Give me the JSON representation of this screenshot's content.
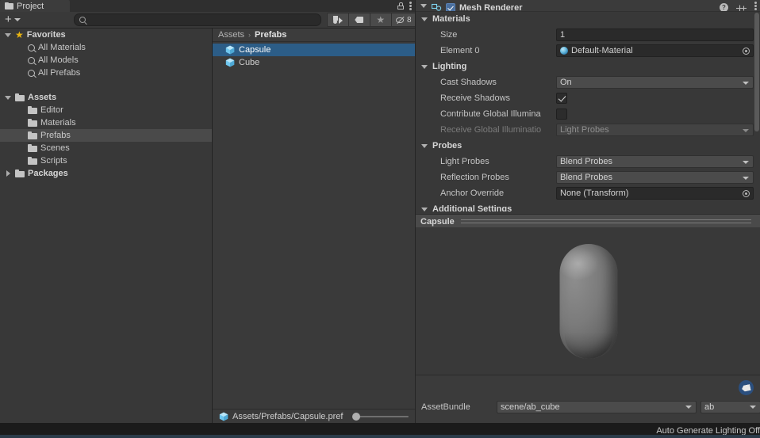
{
  "project_panel": {
    "tab_label": "Project",
    "tab_icon": "folder-icon",
    "lock_icon": "lock-icon",
    "menu_icon": "kebab-menu-icon",
    "toolbar": {
      "add_label": "+",
      "add_icon": "plus-icon",
      "dropdown_icon": "chevron-down-icon",
      "search_placeholder": "",
      "search_value": "",
      "search_icon": "search-icon",
      "filter_type_icon": "type-filter-icon",
      "filter_label_icon": "label-filter-icon",
      "filter_favorite_icon": "star-icon",
      "hidden_icon": "eye-off-icon",
      "hidden_count": "8"
    },
    "tree": [
      {
        "label": "Favorites",
        "icon": "star-icon",
        "indent": 0,
        "arrow": "down",
        "bold": true,
        "selected": false
      },
      {
        "label": "All Materials",
        "icon": "search-icon",
        "indent": 1,
        "arrow": "none",
        "bold": false,
        "selected": false
      },
      {
        "label": "All Models",
        "icon": "search-icon",
        "indent": 1,
        "arrow": "none",
        "bold": false,
        "selected": false
      },
      {
        "label": "All Prefabs",
        "icon": "search-icon",
        "indent": 1,
        "arrow": "none",
        "bold": false,
        "selected": false
      },
      {
        "label": "",
        "icon": "spacer",
        "indent": 0,
        "arrow": "none",
        "bold": false,
        "selected": false
      },
      {
        "label": "Assets",
        "icon": "folder-icon",
        "indent": 0,
        "arrow": "down",
        "bold": true,
        "selected": false
      },
      {
        "label": "Editor",
        "icon": "folder-icon",
        "indent": 1,
        "arrow": "none",
        "bold": false,
        "selected": false
      },
      {
        "label": "Materials",
        "icon": "folder-icon",
        "indent": 1,
        "arrow": "none",
        "bold": false,
        "selected": false
      },
      {
        "label": "Prefabs",
        "icon": "folder-icon",
        "indent": 1,
        "arrow": "none",
        "bold": false,
        "selected": true
      },
      {
        "label": "Scenes",
        "icon": "folder-icon",
        "indent": 1,
        "arrow": "none",
        "bold": false,
        "selected": false
      },
      {
        "label": "Scripts",
        "icon": "folder-icon",
        "indent": 1,
        "arrow": "none",
        "bold": false,
        "selected": false
      },
      {
        "label": "Packages",
        "icon": "folder-icon",
        "indent": 0,
        "arrow": "right",
        "bold": true,
        "selected": false
      }
    ],
    "breadcrumb": [
      {
        "label": "Assets",
        "current": false
      },
      {
        "label": "Prefabs",
        "current": true
      }
    ],
    "breadcrumb_separator": "›",
    "assets": [
      {
        "label": "Capsule",
        "icon": "prefab-icon",
        "selected": true
      },
      {
        "label": "Cube",
        "icon": "prefab-icon",
        "selected": false
      }
    ],
    "footer": {
      "path": "Assets/Prefabs/Capsule.pref",
      "icon": "prefab-icon",
      "zoom_slider_name": "icon-size-slider"
    }
  },
  "inspector": {
    "component_title": "Mesh Renderer",
    "component_icon": "mesh-renderer-icon",
    "enabled_checkbox": true,
    "help_icon": "help-icon",
    "preset_icon": "preset-icon",
    "menu_icon": "kebab-menu-icon",
    "sections": [
      {
        "name": "Materials",
        "title": "Materials",
        "rows": [
          {
            "label": "Size",
            "type": "text",
            "value": "1"
          },
          {
            "label": "Element 0",
            "type": "object",
            "value": "Default-Material"
          }
        ]
      },
      {
        "name": "Lighting",
        "title": "Lighting",
        "rows": [
          {
            "label": "Cast Shadows",
            "type": "popup",
            "value": "On",
            "disabled": false
          },
          {
            "label": "Receive Shadows",
            "type": "checkbox",
            "value": true,
            "disabled": false
          },
          {
            "label": "Contribute Global Illumina",
            "type": "checkbox",
            "value": false,
            "disabled": false
          },
          {
            "label": "Receive Global Illuminatio",
            "type": "popup",
            "value": "Light Probes",
            "disabled": true
          }
        ]
      },
      {
        "name": "Probes",
        "title": "Probes",
        "rows": [
          {
            "label": "Light Probes",
            "type": "popup",
            "value": "Blend Probes"
          },
          {
            "label": "Reflection Probes",
            "type": "popup",
            "value": "Blend Probes"
          },
          {
            "label": "Anchor Override",
            "type": "object2",
            "value": "None (Transform)"
          }
        ]
      },
      {
        "name": "Additional Settings",
        "title": "Additional Settings",
        "rows": []
      }
    ],
    "preview": {
      "title": "Capsule",
      "menu_icon": "kebab-menu-icon",
      "object_icon": "capsule-3d-preview"
    },
    "assetbundle": {
      "tag_badge_icon": "asset-label-icon",
      "label": "AssetBundle",
      "bundle_name": "scene/ab_cube",
      "variant_name": "ab"
    }
  },
  "status_bar": {
    "message": "Auto Generate Lighting Off"
  },
  "colors": {
    "window_bg": "#383838",
    "panel_bg": "#3a3a3a",
    "selection_blue": "#2c5d87",
    "tree_selection": "#4a4a4a",
    "field_bg": "#2a2a2a",
    "popup_bg": "#4b4b4b",
    "text": "#c4c4c4",
    "text_disabled": "#7b7b7b",
    "favorite_star": "#e8b412",
    "status_bar_bg": "#1b1b1b",
    "tag_badge": "#2b4f7e"
  }
}
